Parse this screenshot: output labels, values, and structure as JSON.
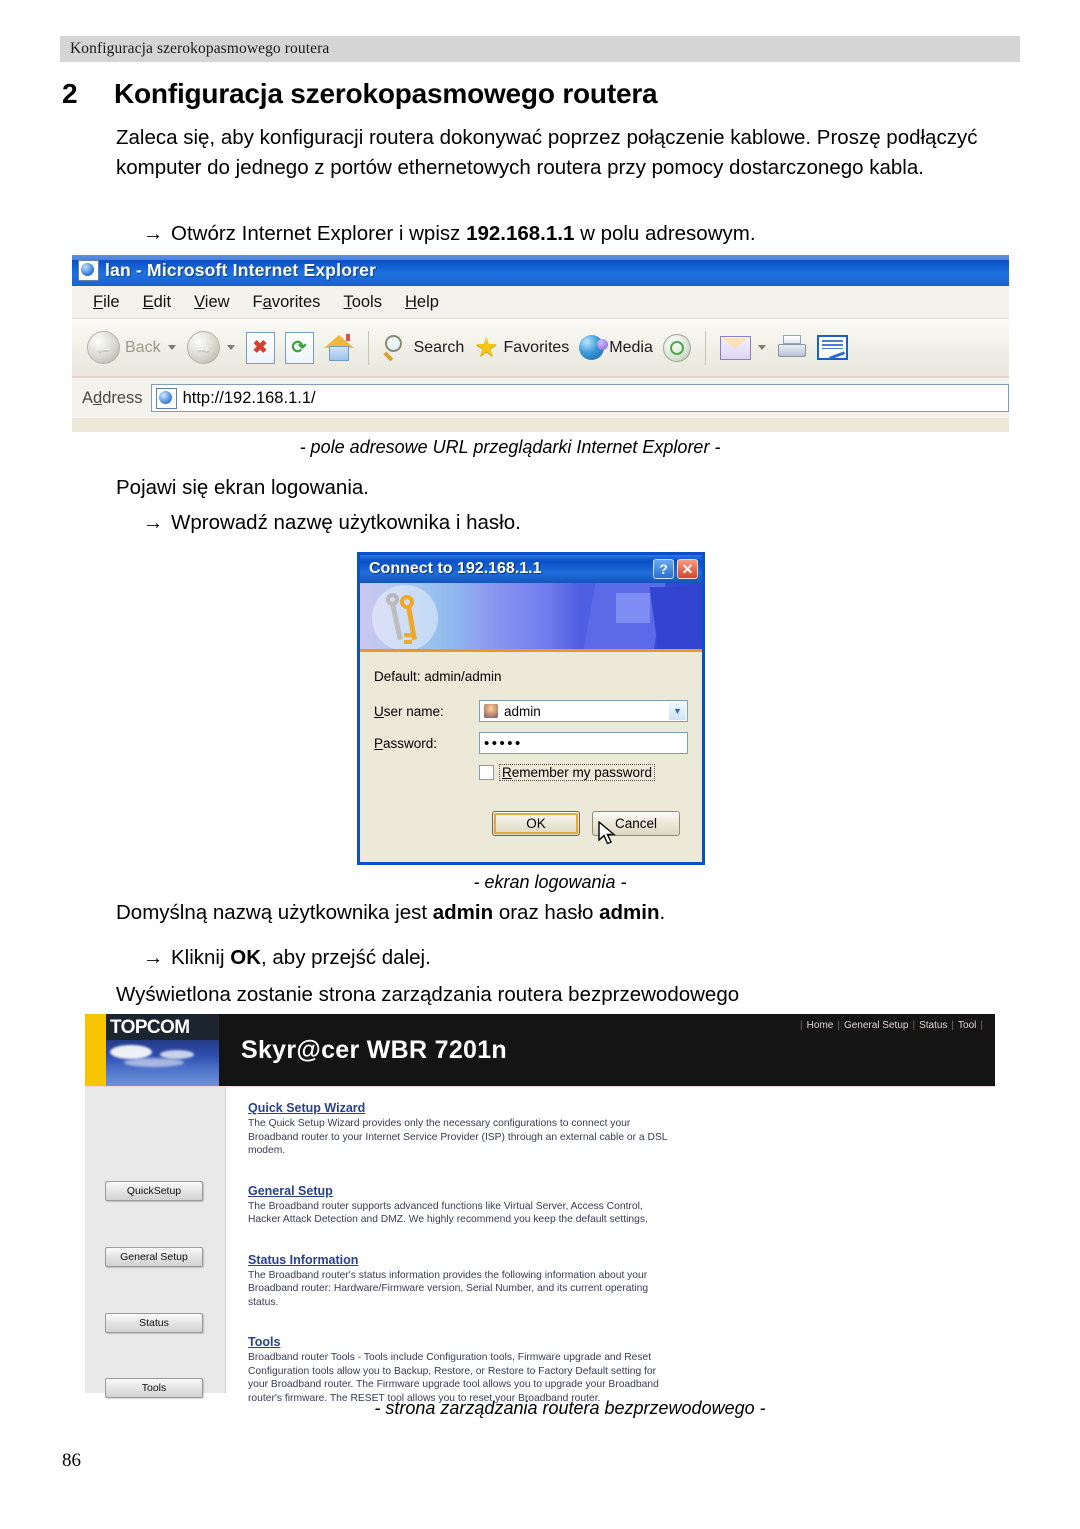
{
  "document": {
    "running_header": "Konfiguracja szerokopasmowego routera",
    "chapter_number": "2",
    "chapter_title": "Konfiguracja szerokopasmowego routera",
    "page_number": "86",
    "intro_paragraph": "Zaleca się, aby konfiguracji routera dokonywać poprzez połączenie kablowe. Proszę podłączyć komputer do jednego z portów ethernetowych routera przy pomocy dostarczonego kabla.",
    "bullet_arrow": "→",
    "bullet_1": "Otwórz Internet Explorer i wpisz 192.168.1.1 w polu adresowym.",
    "bullet_1_pre": "Otwórz Internet Explorer i wpisz ",
    "bullet_1_bold": "192.168.1.1",
    "bullet_1_post": " w polu adresowym.",
    "caption_url": "- pole adresowe URL przeglądarki Internet Explorer -",
    "paragraph_login": "Pojawi się ekran logowania.",
    "bullet_2": "Wprowadź nazwę użytkownika i hasło.",
    "caption_login": "- ekran logowania -",
    "paragraph_default_pre": "Domyślną nazwą użytkownika jest ",
    "paragraph_default_bold1": "admin",
    "paragraph_default_mid": " oraz hasło ",
    "paragraph_default_bold2": "admin",
    "paragraph_default_post": ".",
    "bullet_3_pre": "Kliknij ",
    "bullet_3_bold": "OK",
    "bullet_3_post": ", aby przejść dalej.",
    "paragraph_manage": "Wyświetlona zostanie strona zarządzania routera bezprzewodowego",
    "caption_mgmt": "- strona zarządzania routera bezprzewodowego -"
  },
  "ie_window": {
    "title": "lan - Microsoft Internet Explorer",
    "menu": [
      {
        "pre": "",
        "acc": "F",
        "post": "ile"
      },
      {
        "pre": "",
        "acc": "E",
        "post": "dit"
      },
      {
        "pre": "",
        "acc": "V",
        "post": "iew"
      },
      {
        "pre": "F",
        "acc": "a",
        "post": "vorites"
      },
      {
        "pre": "",
        "acc": "T",
        "post": "ools"
      },
      {
        "pre": "",
        "acc": "H",
        "post": "elp"
      }
    ],
    "toolbar": {
      "back_label": "Back",
      "search_label": "Search",
      "favorites_label": "Favorites",
      "media_label": "Media"
    },
    "address": {
      "label_pre": "A",
      "label_acc": "d",
      "label_post": "dress",
      "value": "http://192.168.1.1/"
    }
  },
  "connect_dialog": {
    "title": "Connect to 192.168.1.1",
    "help_button": "?",
    "close_button": "✕",
    "default_hint": "Default: admin/admin",
    "username_label_pre": "",
    "username_label_acc": "U",
    "username_label_post": "ser name:",
    "username_value": "admin",
    "password_label_acc": "P",
    "password_label_post": "assword:",
    "password_value": "•••••",
    "remember_label_acc": "R",
    "remember_label_pre": "",
    "remember_label_post": "emember my password",
    "ok_button": "OK",
    "cancel_button": "Cancel"
  },
  "router_page": {
    "brand": "TOPCOM",
    "model": "Skyr@cer WBR 7201n",
    "nav": [
      "Home",
      "General Setup",
      "Status",
      "Tool"
    ],
    "side_buttons": [
      "QuickSetup",
      "General Setup",
      "Status",
      "Tools"
    ],
    "sections": [
      {
        "title": "Quick Setup Wizard",
        "desc": "The Quick Setup Wizard provides only the necessary configurations to connect your Broadband router to your Internet Service Provider (ISP) through an external cable or a DSL modem."
      },
      {
        "title": "General Setup",
        "desc": "The Broadband router supports advanced functions like Virtual Server, Access Control, Hacker Attack Detection and DMZ. We highly recommend you keep the default settings."
      },
      {
        "title": "Status Information",
        "desc": "The Broadband router's status information provides the following information about your Broadband router: Hardware/Firmware version, Serial Number, and its current operating status."
      },
      {
        "title": "Tools",
        "desc": "Broadband router Tools - Tools include Configuration tools, Firmware upgrade and Reset Configuration tools allow you to Backup, Restore, or Restore to Factory Default setting for your Broadband router. The Firmware upgrade tool allows you to upgrade your Broadband router's firmware. The RESET tool allows you to reset your Broadband router."
      }
    ]
  },
  "colors": {
    "header_band": "#d5d5d5",
    "ie_title_blue": "#0a50c8",
    "router_black": "#141414",
    "router_yellow": "#f7c500",
    "link_blue": "#29408f"
  }
}
